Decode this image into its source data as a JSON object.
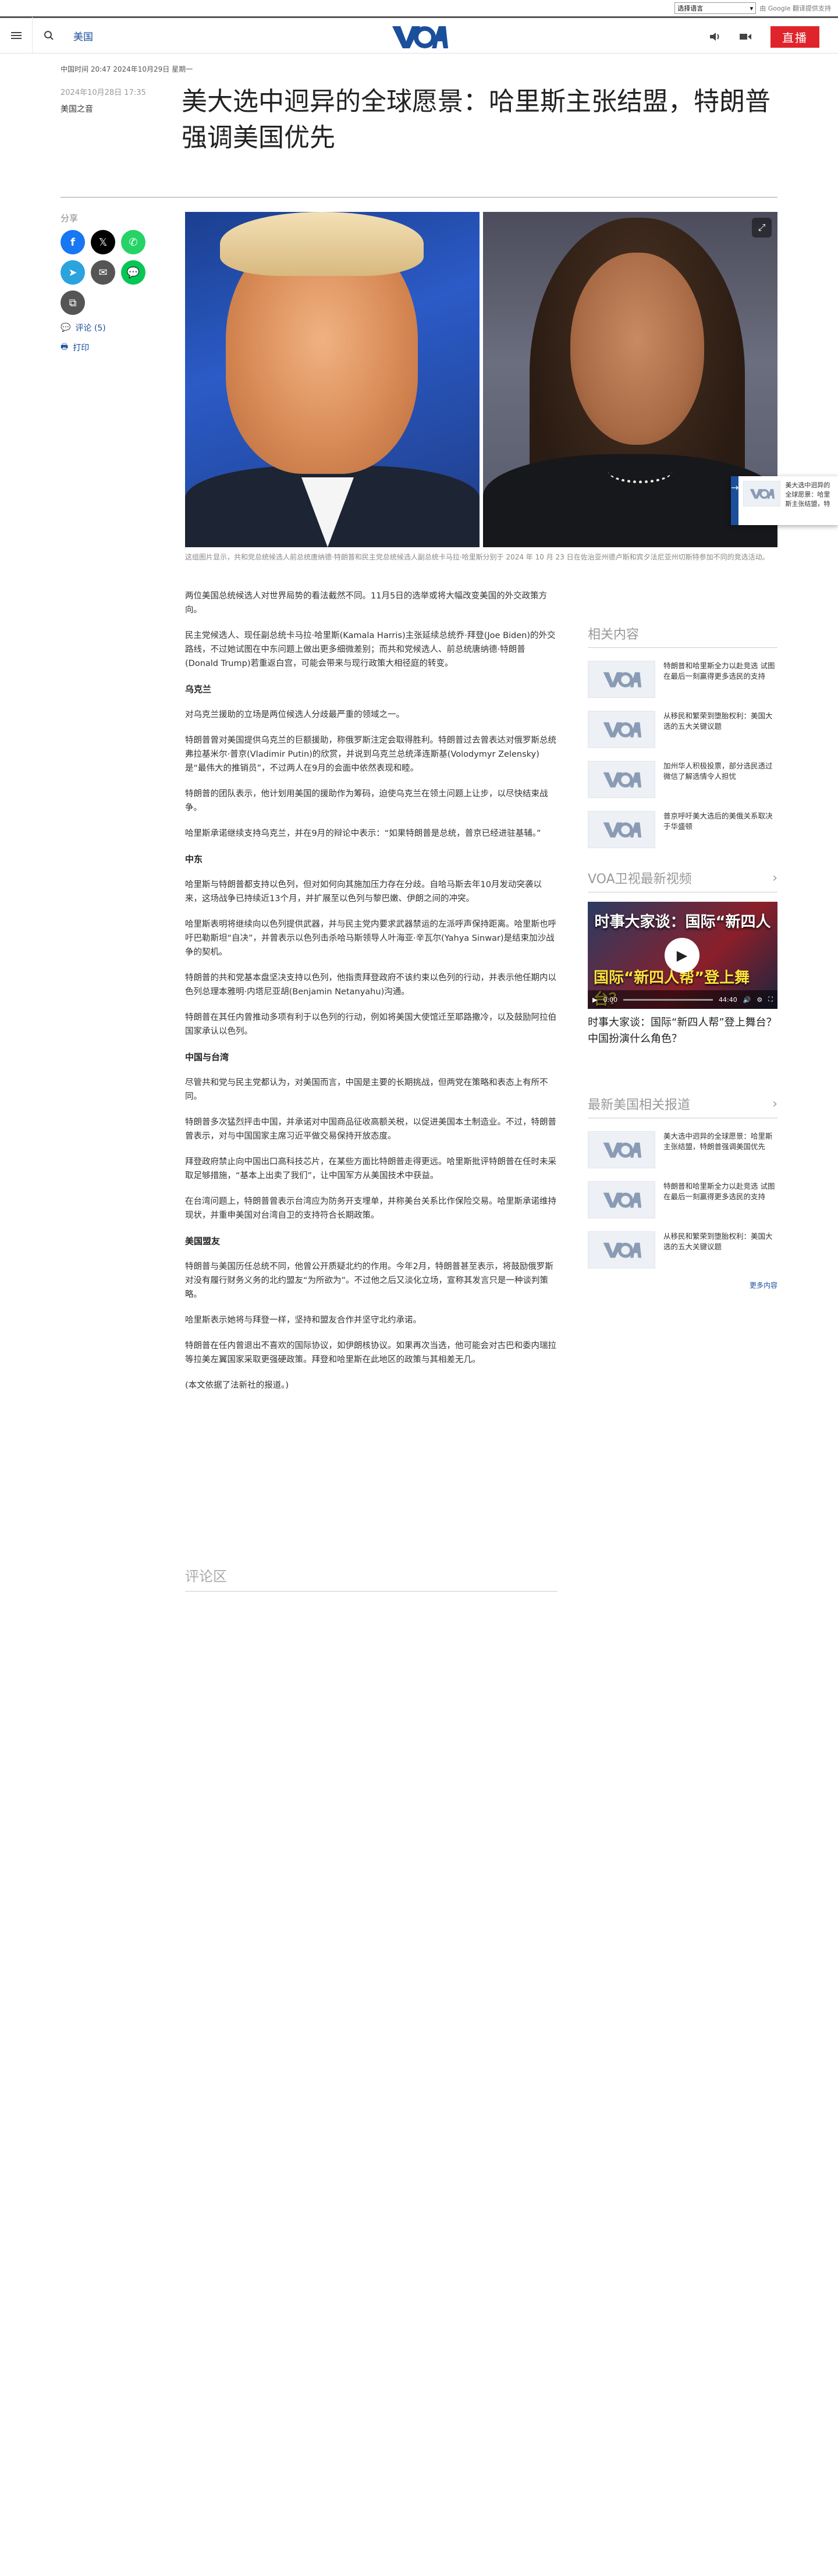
{
  "translate": {
    "select_label": "选择语言",
    "powered_by": "由 Google 翻译提供支持"
  },
  "header": {
    "section": "美国",
    "live": "直播",
    "logo_text": "VOA"
  },
  "timestamp_line": "中国时间 20:47 2024年10月29日 星期一",
  "article": {
    "date": "2024年10月28日 17:35",
    "author": "美国之音",
    "title": "美大选中迥异的全球愿景：哈里斯主张结盟，特朗普强调美国优先",
    "share_label": "分享",
    "comments_link": "评论 (5)",
    "print_link": "打印",
    "caption": "这组图片显示，共和党总统候选人前总统唐纳德·特朗普和民主党总统候选人副总统卡马拉·哈里斯分别于 2024 年 10 月 23 日在佐治亚州德卢斯和宾夕法尼亚州切斯特参加不同的竞选活动。",
    "paragraphs": [
      {
        "type": "p",
        "text": "两位美国总统候选人对世界局势的看法截然不同。11月5日的选举或将大幅改变美国的外交政策方向。"
      },
      {
        "type": "p",
        "text": "民主党候选人、现任副总统卡马拉·哈里斯(Kamala Harris)主张延续总统乔·拜登(Joe Biden)的外交路线，不过她试图在中东问题上做出更多细微差别；而共和党候选人、前总统唐纳德·特朗普(Donald Trump)若重返白宫，可能会带来与现行政策大相径庭的转变。"
      },
      {
        "type": "h",
        "text": "乌克兰"
      },
      {
        "type": "p",
        "text": "对乌克兰援助的立场是两位候选人分歧最严重的领域之一。"
      },
      {
        "type": "p",
        "text": "特朗普曾对美国提供乌克兰的巨额援助，称俄罗斯注定会取得胜利。特朗普过去曾表达对俄罗斯总统弗拉基米尔·普京(Vladimir Putin)的欣赏，并说到乌克兰总统泽连斯基(Volodymyr Zelensky)是“最伟大的推销员”，不过两人在9月的会面中依然表现和睦。"
      },
      {
        "type": "p",
        "text": "特朗普的团队表示，他计划用美国的援助作为筹码，迫使乌克兰在领土问题上让步，以尽快结束战争。"
      },
      {
        "type": "p",
        "text": "哈里斯承诺继续支持乌克兰，并在9月的辩论中表示：“如果特朗普是总统，普京已经进驻基辅。”"
      },
      {
        "type": "h",
        "text": "中东"
      },
      {
        "type": "p",
        "text": "哈里斯与特朗普都支持以色列，但对如何向其施加压力存在分歧。自哈马斯去年10月发动突袭以来，这场战争已持续近13个月，并扩展至以色列与黎巴嫩、伊朗之间的冲突。"
      },
      {
        "type": "p",
        "text": "哈里斯表明将继续向以色列提供武器，并与民主党内要求武器禁运的左派呼声保持距离。哈里斯也呼吁巴勒斯坦“自决”，并曾表示以色列击杀哈马斯领导人叶海亚·辛瓦尔(Yahya Sinwar)是结束加沙战争的契机。"
      },
      {
        "type": "p",
        "text": "特朗普的共和党基本盘坚决支持以色列，他指责拜登政府不该约束以色列的行动，并表示他任期内以色列总理本雅明·内塔尼亚胡(Benjamin Netanyahu)沟通。"
      },
      {
        "type": "p",
        "text": "特朗普在其任内曾推动多项有利于以色列的行动，例如将美国大使馆迁至耶路撒冷，以及鼓励阿拉伯国家承认以色列。"
      },
      {
        "type": "h",
        "text": "中国与台湾"
      },
      {
        "type": "p",
        "text": "尽管共和党与民主党都认为，对美国而言，中国是主要的长期挑战，但两党在策略和表态上有所不同。"
      },
      {
        "type": "p",
        "text": "特朗普多次猛烈抨击中国，并承诺对中国商品征收高额关税，以促进美国本土制造业。不过，特朗普曾表示，对与中国国家主席习近平做交易保持开放态度。"
      },
      {
        "type": "p",
        "text": "拜登政府禁止向中国出口高科技芯片，在某些方面比特朗普走得更远。哈里斯批评特朗普在任时未采取足够措施，“基本上出卖了我们”，让中国军方从美国技术中获益。"
      },
      {
        "type": "p",
        "text": "在台湾问题上，特朗普曾表示台湾应为防务开支埋单，并称美台关系比作保险交易。哈里斯承诺维持现状，并重申美国对台湾自卫的支持符合长期政策。"
      },
      {
        "type": "h",
        "text": "美国盟友"
      },
      {
        "type": "p",
        "text": "特朗普与美国历任总统不同，他曾公开质疑北约的作用。今年2月，特朗普甚至表示，将鼓励俄罗斯对没有履行财务义务的北约盟友“为所欲为”。不过他之后又淡化立场，宣称其发言只是一种谈判策略。"
      },
      {
        "type": "p",
        "text": "哈里斯表示她将与拜登一样，坚持和盟友合作并坚守北约承诺。"
      },
      {
        "type": "p",
        "text": "特朗普在任内曾退出不喜欢的国际协议，如伊朗核协议。如果再次当选，他可能会对古巴和委内瑞拉等拉美左翼国家采取更强硬政策。拜登和哈里斯在此地区的政策与其相差无几。"
      },
      {
        "type": "p",
        "text": "(本文依据了法新社的报道。)"
      }
    ],
    "comments_heading": "评论区"
  },
  "sidebar": {
    "related_heading": "相关内容",
    "related": [
      "特朗普和哈里斯全力以赴竞选 试图在最后一刻赢得更多选民的支持",
      "从移民和繁荣到堕胎权利：美国大选的五大关键议题",
      "加州华人积极投票，部分选民透过微信了解选情令人担忧",
      "普京呼吁美大选后的美俄关系取决于华盛顿"
    ],
    "video_heading": "VOA卫视最新视频",
    "video_banner_top": "时事大家谈：国际“新四人",
    "video_banner_bottom": "国际“新四人帮”登上舞台？",
    "video_time": "0:00",
    "video_duration": "44:40",
    "video_title": "时事大家谈：国际“新四人帮”登上舞台？中国扮演什么角色？",
    "latest_heading": "最新美国相关报道",
    "latest": [
      "美大选中迥异的全球愿景：哈里斯主张结盟，特朗普强调美国优先",
      "特朗普和哈里斯全力以赴竞选 试图在最后一刻赢得更多选民的支持",
      "从移民和繁荣到堕胎权利：美国大选的五大关键议题"
    ],
    "more": "更多内容"
  },
  "float_card": {
    "text": "美大选中迥异的全球愿景：哈里斯主张结盟，特朗普强调美国优先"
  },
  "colors": {
    "brand_blue": "#1b4f9c",
    "live_red": "#e0242b"
  }
}
